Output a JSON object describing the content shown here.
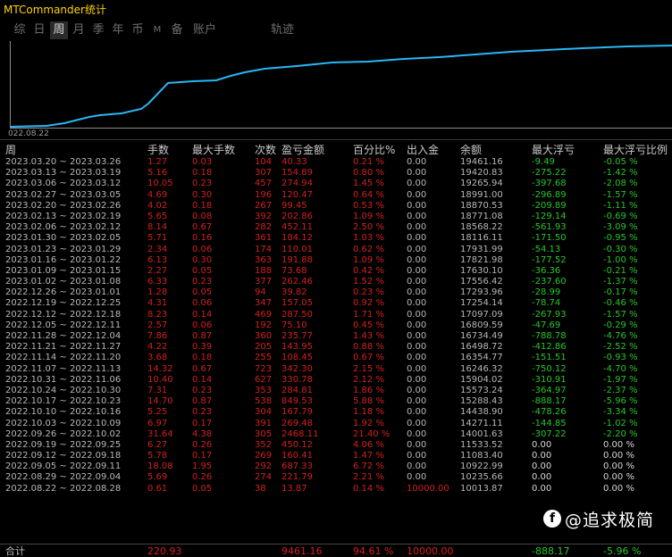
{
  "app": {
    "title": "MTCommander统计"
  },
  "tabs": [
    {
      "label": "综",
      "active": false
    },
    {
      "label": "日",
      "active": false
    },
    {
      "label": "周",
      "active": true
    },
    {
      "label": "月",
      "active": false
    },
    {
      "label": "季",
      "active": false
    },
    {
      "label": "年",
      "active": false
    },
    {
      "label": "币",
      "active": false
    },
    {
      "label": "M",
      "active": false
    },
    {
      "label": "备",
      "active": false
    },
    {
      "label": "账户",
      "active": false
    },
    {
      "label": "轨迹",
      "active": false
    }
  ],
  "chart": {
    "x_start_label": "022.08.22",
    "line_color": "#29b6f6"
  },
  "table": {
    "headers": {
      "week": "周",
      "lots": "手数",
      "max_lots": "最大手数",
      "count": "次数",
      "pnl": "盈亏金额",
      "pct": "百分比%",
      "io": "出入金",
      "balance": "余额",
      "max_float": "最大浮亏",
      "max_float_pct": "最大浮亏比例"
    },
    "rows": [
      {
        "week": "2023.03.20 ~ 2023.03.26",
        "lots": "1.27",
        "max_lots": "0.03",
        "count": "104",
        "pnl": "40.33",
        "pct": "0.21 %",
        "io": "0.00",
        "balance": "19461.16",
        "max_float": "-9.49",
        "max_float_pct": "-0.05 %"
      },
      {
        "week": "2023.03.13 ~ 2023.03.19",
        "lots": "5.16",
        "max_lots": "0.18",
        "count": "307",
        "pnl": "154.89",
        "pct": "0.80 %",
        "io": "0.00",
        "balance": "19420.83",
        "max_float": "-275.22",
        "max_float_pct": "-1.42 %"
      },
      {
        "week": "2023.03.06 ~ 2023.03.12",
        "lots": "10.05",
        "max_lots": "0.23",
        "count": "457",
        "pnl": "274.94",
        "pct": "1.45 %",
        "io": "0.00",
        "balance": "19265.94",
        "max_float": "-397.68",
        "max_float_pct": "-2.08 %"
      },
      {
        "week": "2023.02.27 ~ 2023.03.05",
        "lots": "4.69",
        "max_lots": "0.30",
        "count": "196",
        "pnl": "120.47",
        "pct": "0.64 %",
        "io": "0.00",
        "balance": "18991.00",
        "max_float": "-296.89",
        "max_float_pct": "-1.57 %"
      },
      {
        "week": "2023.02.20 ~ 2023.02.26",
        "lots": "4.02",
        "max_lots": "0.18",
        "count": "267",
        "pnl": "99.45",
        "pct": "0.53 %",
        "io": "0.00",
        "balance": "18870.53",
        "max_float": "-209.89",
        "max_float_pct": "-1.11 %"
      },
      {
        "week": "2023.02.13 ~ 2023.02.19",
        "lots": "5.65",
        "max_lots": "0.08",
        "count": "392",
        "pnl": "202.86",
        "pct": "1.09 %",
        "io": "0.00",
        "balance": "18771.08",
        "max_float": "-129.14",
        "max_float_pct": "-0.69 %"
      },
      {
        "week": "2023.02.06 ~ 2023.02.12",
        "lots": "8.14",
        "max_lots": "0.67",
        "count": "282",
        "pnl": "452.11",
        "pct": "2.50 %",
        "io": "0.00",
        "balance": "18568.22",
        "max_float": "-561.93",
        "max_float_pct": "-3.09 %"
      },
      {
        "week": "2023.01.30 ~ 2023.02.05",
        "lots": "5.71",
        "max_lots": "0.16",
        "count": "361",
        "pnl": "184.12",
        "pct": "1.03 %",
        "io": "0.00",
        "balance": "18116.11",
        "max_float": "-171.50",
        "max_float_pct": "-0.95 %"
      },
      {
        "week": "2023.01.23 ~ 2023.01.29",
        "lots": "2.34",
        "max_lots": "0.06",
        "count": "174",
        "pnl": "110.01",
        "pct": "0.62 %",
        "io": "0.00",
        "balance": "17931.99",
        "max_float": "-54.13",
        "max_float_pct": "-0.30 %"
      },
      {
        "week": "2023.01.16 ~ 2023.01.22",
        "lots": "6.13",
        "max_lots": "0.30",
        "count": "363",
        "pnl": "191.88",
        "pct": "1.09 %",
        "io": "0.00",
        "balance": "17821.98",
        "max_float": "-177.52",
        "max_float_pct": "-1.00 %"
      },
      {
        "week": "2023.01.09 ~ 2023.01.15",
        "lots": "2.27",
        "max_lots": "0.05",
        "count": "188",
        "pnl": "73.68",
        "pct": "0.42 %",
        "io": "0.00",
        "balance": "17630.10",
        "max_float": "-36.36",
        "max_float_pct": "-0.21 %"
      },
      {
        "week": "2023.01.02 ~ 2023.01.08",
        "lots": "6.33",
        "max_lots": "0.23",
        "count": "377",
        "pnl": "262.46",
        "pct": "1.52 %",
        "io": "0.00",
        "balance": "17556.42",
        "max_float": "-237.60",
        "max_float_pct": "-1.37 %"
      },
      {
        "week": "2022.12.26 ~ 2023.01.01",
        "lots": "1.28",
        "max_lots": "0.05",
        "count": "94",
        "pnl": "39.82",
        "pct": "0.23 %",
        "io": "0.00",
        "balance": "17293.96",
        "max_float": "-28.99",
        "max_float_pct": "-0.17 %"
      },
      {
        "week": "2022.12.19 ~ 2022.12.25",
        "lots": "4.31",
        "max_lots": "0.06",
        "count": "347",
        "pnl": "157.05",
        "pct": "0.92 %",
        "io": "0.00",
        "balance": "17254.14",
        "max_float": "-78.74",
        "max_float_pct": "-0.46 %"
      },
      {
        "week": "2022.12.12 ~ 2022.12.18",
        "lots": "8.23",
        "max_lots": "0.14",
        "count": "469",
        "pnl": "287.50",
        "pct": "1.71 %",
        "io": "0.00",
        "balance": "17097.09",
        "max_float": "-267.93",
        "max_float_pct": "-1.57 %"
      },
      {
        "week": "2022.12.05 ~ 2022.12.11",
        "lots": "2.57",
        "max_lots": "0.06",
        "count": "192",
        "pnl": "75.10",
        "pct": "0.45 %",
        "io": "0.00",
        "balance": "16809.59",
        "max_float": "-47.69",
        "max_float_pct": "-0.29 %"
      },
      {
        "week": "2022.11.28 ~ 2022.12.04",
        "lots": "7.86",
        "max_lots": "0.87",
        "count": "360",
        "pnl": "235.77",
        "pct": "1.43 %",
        "io": "0.00",
        "balance": "16734.49",
        "max_float": "-788.78",
        "max_float_pct": "-4.76 %"
      },
      {
        "week": "2022.11.21 ~ 2022.11.27",
        "lots": "4.22",
        "max_lots": "0.39",
        "count": "205",
        "pnl": "143.95",
        "pct": "0.88 %",
        "io": "0.00",
        "balance": "16498.72",
        "max_float": "-412.86",
        "max_float_pct": "-2.52 %"
      },
      {
        "week": "2022.11.14 ~ 2022.11.20",
        "lots": "3.68",
        "max_lots": "0.18",
        "count": "255",
        "pnl": "108.45",
        "pct": "0.67 %",
        "io": "0.00",
        "balance": "16354.77",
        "max_float": "-151.51",
        "max_float_pct": "-0.93 %"
      },
      {
        "week": "2022.11.07 ~ 2022.11.13",
        "lots": "14.32",
        "max_lots": "0.67",
        "count": "723",
        "pnl": "342.30",
        "pct": "2.15 %",
        "io": "0.00",
        "balance": "16246.32",
        "max_float": "-750.12",
        "max_float_pct": "-4.70 %"
      },
      {
        "week": "2022.10.31 ~ 2022.11.06",
        "lots": "10.40",
        "max_lots": "0.14",
        "count": "627",
        "pnl": "330.78",
        "pct": "2.12 %",
        "io": "0.00",
        "balance": "15904.02",
        "max_float": "-310.91",
        "max_float_pct": "-1.97 %"
      },
      {
        "week": "2022.10.24 ~ 2022.10.30",
        "lots": "7.31",
        "max_lots": "0.23",
        "count": "353",
        "pnl": "284.81",
        "pct": "1.86 %",
        "io": "0.00",
        "balance": "15573.24",
        "max_float": "-364.97",
        "max_float_pct": "-2.37 %"
      },
      {
        "week": "2022.10.17 ~ 2022.10.23",
        "lots": "14.70",
        "max_lots": "0.87",
        "count": "538",
        "pnl": "849.53",
        "pct": "5.88 %",
        "io": "0.00",
        "balance": "15288.43",
        "max_float": "-888.17",
        "max_float_pct": "-5.96 %"
      },
      {
        "week": "2022.10.10 ~ 2022.10.16",
        "lots": "5.25",
        "max_lots": "0.23",
        "count": "304",
        "pnl": "167.79",
        "pct": "1.18 %",
        "io": "0.00",
        "balance": "14438.90",
        "max_float": "-478.26",
        "max_float_pct": "-3.34 %"
      },
      {
        "week": "2022.10.03 ~ 2022.10.09",
        "lots": "6.97",
        "max_lots": "0.17",
        "count": "391",
        "pnl": "269.48",
        "pct": "1.92 %",
        "io": "0.00",
        "balance": "14271.11",
        "max_float": "-144.85",
        "max_float_pct": "-1.02 %"
      },
      {
        "week": "2022.09.26 ~ 2022.10.02",
        "lots": "31.64",
        "max_lots": "4.38",
        "count": "305",
        "pnl": "2468.11",
        "pct": "21.40 %",
        "io": "0.00",
        "balance": "14001.63",
        "max_float": "-307.22",
        "max_float_pct": "-2.20 %"
      },
      {
        "week": "2022.09.19 ~ 2022.09.25",
        "lots": "6.27",
        "max_lots": "0.26",
        "count": "352",
        "pnl": "450.12",
        "pct": "4.06 %",
        "io": "0.00",
        "balance": "11533.52",
        "max_float": "0.00",
        "max_float_pct": "0.00 %"
      },
      {
        "week": "2022.09.12 ~ 2022.09.18",
        "lots": "5.78",
        "max_lots": "0.17",
        "count": "269",
        "pnl": "160.41",
        "pct": "1.47 %",
        "io": "0.00",
        "balance": "11083.40",
        "max_float": "0.00",
        "max_float_pct": "0.00 %"
      },
      {
        "week": "2022.09.05 ~ 2022.09.11",
        "lots": "18.08",
        "max_lots": "1.95",
        "count": "292",
        "pnl": "687.33",
        "pct": "6.72 %",
        "io": "0.00",
        "balance": "10922.99",
        "max_float": "0.00",
        "max_float_pct": "0.00 %"
      },
      {
        "week": "2022.08.29 ~ 2022.09.04",
        "lots": "5.69",
        "max_lots": "0.26",
        "count": "274",
        "pnl": "221.79",
        "pct": "2.21 %",
        "io": "0.00",
        "balance": "10235.66",
        "max_float": "0.00",
        "max_float_pct": "0.00 %"
      },
      {
        "week": "2022.08.22 ~ 2022.08.28",
        "lots": "0.61",
        "max_lots": "0.05",
        "count": "38",
        "pnl": "13.87",
        "pct": "0.14 %",
        "io": "10000.00",
        "balance": "10013.87",
        "max_float": "0.00",
        "max_float_pct": "0.00 %"
      }
    ],
    "total": {
      "label": "合计",
      "lots": "220.93",
      "pnl": "9461.16",
      "pct": "94.61 %",
      "io": "10000.00",
      "max_float": "-888.17",
      "max_float_pct": "-5.96 %"
    }
  },
  "watermark": {
    "icon": "f",
    "text": "@追求极简"
  }
}
